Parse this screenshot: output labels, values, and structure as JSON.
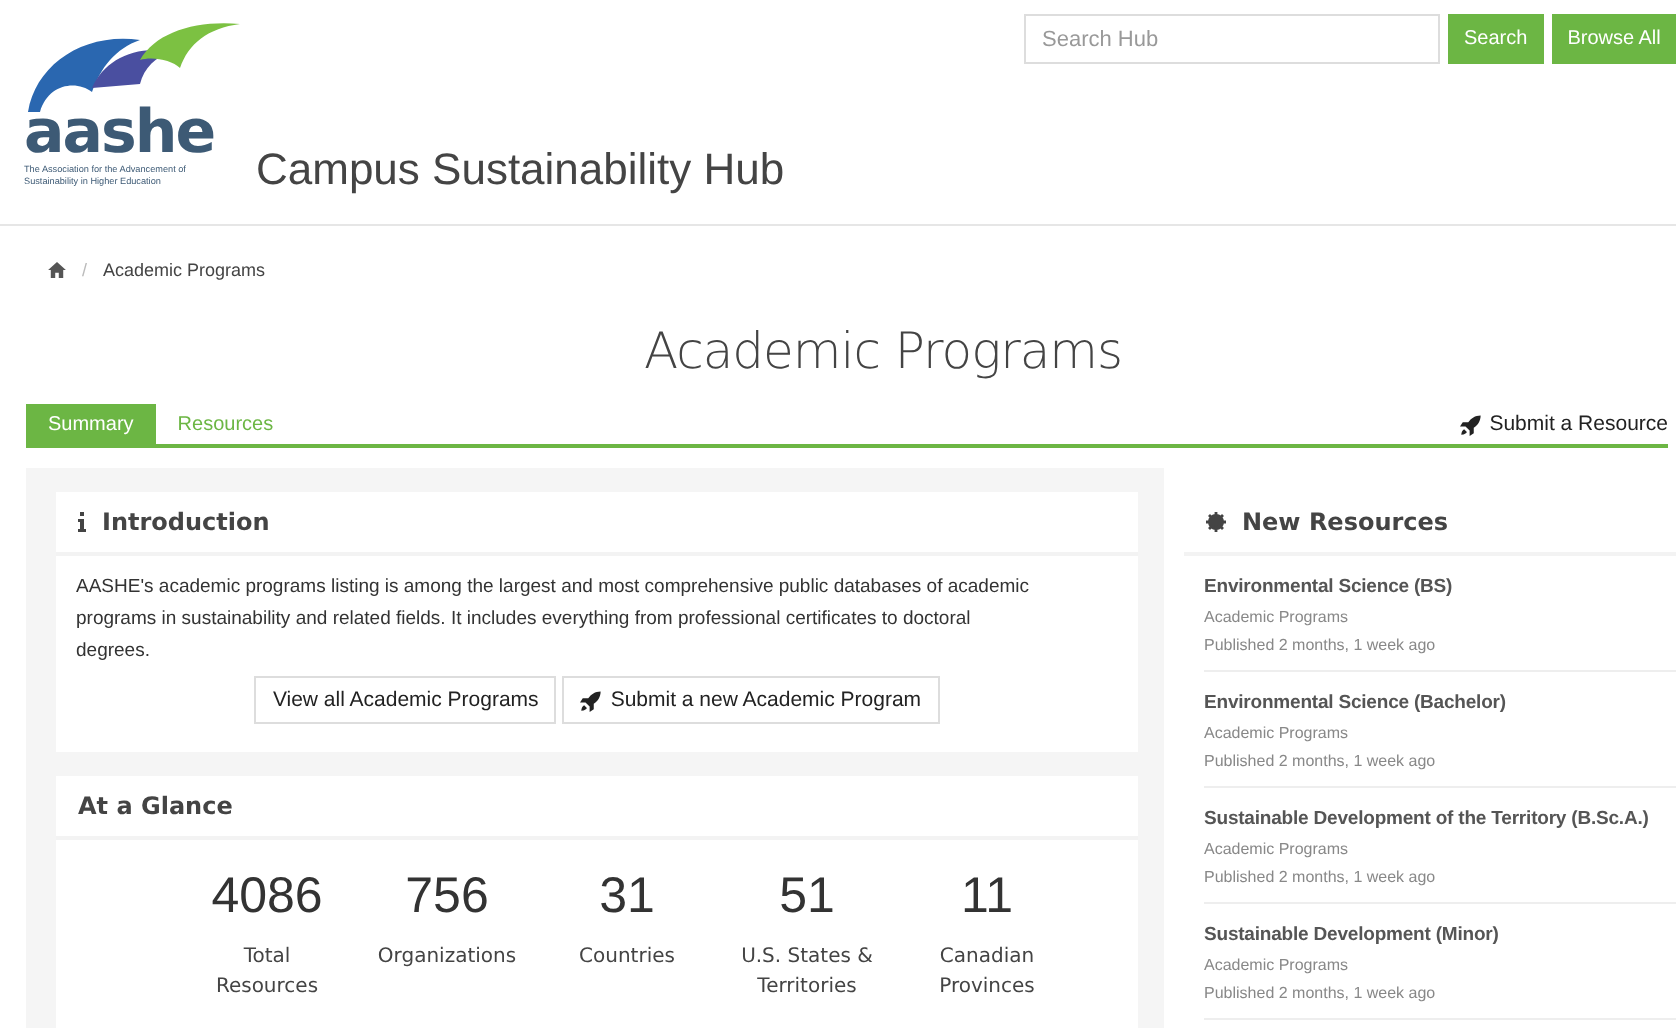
{
  "header": {
    "logo": {
      "wordmark": "aashe",
      "tagline": "The Association for the Advancement of Sustainability in Higher Education"
    },
    "site_title": "Campus Sustainability Hub",
    "search": {
      "placeholder": "Search Hub"
    },
    "buttons": [
      "Search",
      "Browse All"
    ]
  },
  "breadcrumb": {
    "separator": "/",
    "items": [
      "Academic Programs"
    ]
  },
  "page_title": "Academic Programs",
  "tabs": [
    {
      "label": "Summary",
      "selected": true
    },
    {
      "label": "Resources",
      "selected": false
    }
  ],
  "submit_link": "Submit a Resource",
  "introduction": {
    "title": "Introduction",
    "text": "AASHE's academic programs listing is among the largest and most comprehensive public databases of academic programs in sustainability and related fields. It includes everything from professional certificates to doctoral degrees.",
    "buttons": [
      {
        "label": "View all Academic Programs",
        "kind": "plain"
      },
      {
        "label": "Submit a new Academic Program",
        "kind": "rocket"
      }
    ]
  },
  "at_a_glance": {
    "title": "At a Glance",
    "stats": [
      {
        "value": "4086",
        "label": "Total Resources"
      },
      {
        "value": "756",
        "label": "Organizations"
      },
      {
        "value": "31",
        "label": "Countries"
      },
      {
        "value": "51",
        "label": "U.S. States & Territories"
      },
      {
        "value": "11",
        "label": "Canadian Provinces"
      }
    ]
  },
  "new_resources": {
    "title": "New Resources",
    "items": [
      {
        "title": "Environmental Science (BS)",
        "category": "Academic Programs",
        "published": "Published 2 months, 1 week ago"
      },
      {
        "title": "Environmental Science (Bachelor)",
        "category": "Academic Programs",
        "published": "Published 2 months, 1 week ago"
      },
      {
        "title": "Sustainable Development of the Territory (B.Sc.A.)",
        "category": "Academic Programs",
        "published": "Published 2 months, 1 week ago"
      },
      {
        "title": "Sustainable Development (Minor)",
        "category": "Academic Programs",
        "published": "Published 2 months, 1 week ago"
      }
    ]
  }
}
